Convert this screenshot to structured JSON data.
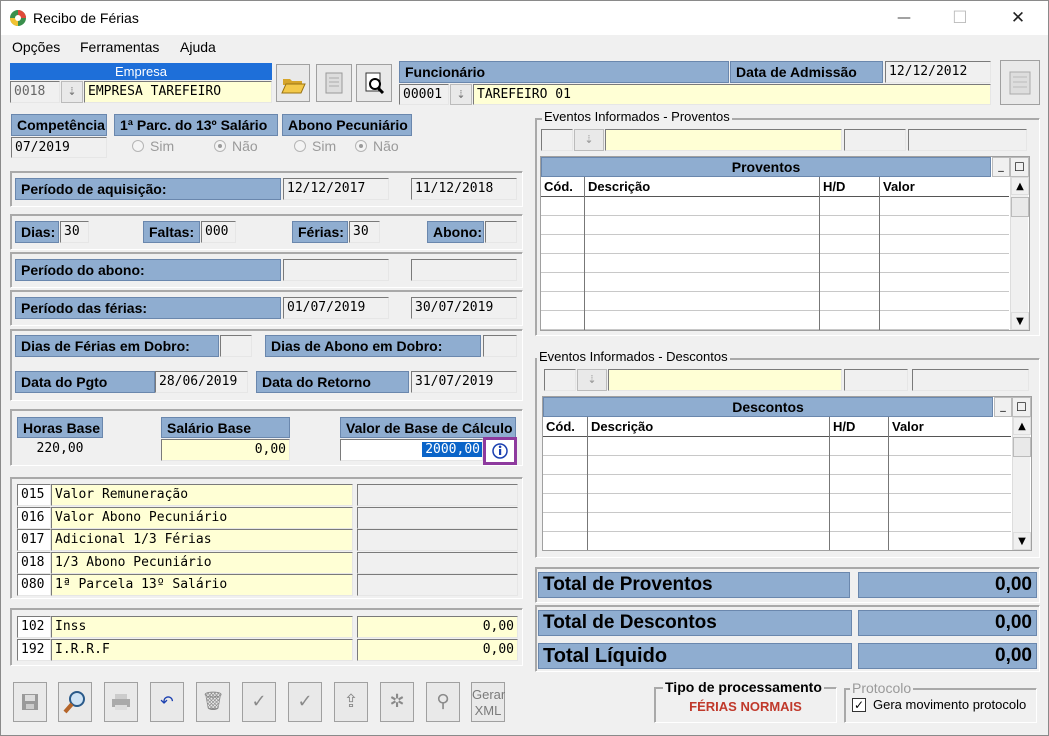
{
  "window": {
    "title": "Recibo de Férias",
    "minimize": "—",
    "maximize": "☐",
    "close": "✕"
  },
  "menu": [
    "Opções",
    "Ferramentas",
    "Ajuda"
  ],
  "empresa": {
    "label": "Empresa",
    "code": "0018",
    "name": "EMPRESA TAREFEIRO"
  },
  "funcionario": {
    "label": "Funcionário",
    "code": "00001",
    "name": "TAREFEIRO 01"
  },
  "admissao": {
    "label": "Data de Admissão",
    "value": "12/12/2012"
  },
  "competencia": {
    "label": "Competência",
    "value": "07/2019"
  },
  "parc13": {
    "label": "1ª Parc. do 13º Salário",
    "sim": "Sim",
    "nao": "Não"
  },
  "abono_pec": {
    "label": "Abono Pecuniário",
    "sim": "Sim",
    "nao": "Não"
  },
  "aquisicao": {
    "label": "Período de aquisição:",
    "start": "12/12/2017",
    "end": "11/12/2018"
  },
  "dias": {
    "dias_label": "Dias:",
    "dias": "30",
    "faltas_label": "Faltas:",
    "faltas": "000",
    "ferias_label": "Férias:",
    "ferias": "30",
    "abono_label": "Abono:",
    "abono": ""
  },
  "periodo_abono": {
    "label": "Período do abono:",
    "start": "",
    "end": ""
  },
  "periodo_ferias": {
    "label": "Período das férias:",
    "start": "01/07/2019",
    "end": "30/07/2019"
  },
  "dobro": {
    "ferias_label": "Dias de Férias em Dobro:",
    "ferias": "",
    "abono_label": "Dias de Abono em Dobro:",
    "abono": ""
  },
  "pgto": {
    "label": "Data do Pgto",
    "value": "28/06/2019",
    "retorno_label": "Data do Retorno",
    "retorno": "31/07/2019"
  },
  "bases": {
    "horas_label": "Horas Base",
    "horas": "220,00",
    "salario_label": "Salário Base",
    "salario": "0,00",
    "calc_label": "Valor de Base de Cálculo",
    "calc": "2000,00"
  },
  "eventos": [
    {
      "code": "015",
      "desc": "Valor Remuneração",
      "value": ""
    },
    {
      "code": "016",
      "desc": "Valor Abono Pecuniário",
      "value": ""
    },
    {
      "code": "017",
      "desc": "Adicional 1/3 Férias",
      "value": ""
    },
    {
      "code": "018",
      "desc": "1/3 Abono Pecuniário",
      "value": ""
    },
    {
      "code": "080",
      "desc": "1ª Parcela 13º Salário",
      "value": ""
    }
  ],
  "descontos_fix": [
    {
      "code": "102",
      "desc": "Inss",
      "value": "0,00"
    },
    {
      "code": "192",
      "desc": "I.R.R.F",
      "value": "0,00"
    }
  ],
  "proventos_group": {
    "legend": "Eventos Informados - Proventos",
    "grid_title": "Proventos",
    "cols": [
      "Cód.",
      "Descrição",
      "H/D",
      "Valor"
    ]
  },
  "descontos_group": {
    "legend": "Eventos Informados - Descontos",
    "grid_title": "Descontos",
    "cols": [
      "Cód.",
      "Descrição",
      "H/D",
      "Valor"
    ]
  },
  "totais": {
    "proventos_label": "Total de Proventos",
    "proventos": "0,00",
    "descontos_label": "Total de Descontos",
    "descontos": "0,00",
    "liquido_label": "Total Líquido",
    "liquido": "0,00"
  },
  "toolbar": {
    "gerar_xml": "Gerar XML"
  },
  "tipo": {
    "label": "Tipo de processamento",
    "value": "FÉRIAS NORMAIS"
  },
  "protocolo": {
    "legend": "Protocolo",
    "check_label": "Gera movimento protocolo",
    "checked": true
  },
  "colors": {
    "header_blue": "#8fadd0",
    "field_yellow": "#ffffd5",
    "highlight_border": "#8e3a9e",
    "tipo_red": "#c0392b"
  }
}
